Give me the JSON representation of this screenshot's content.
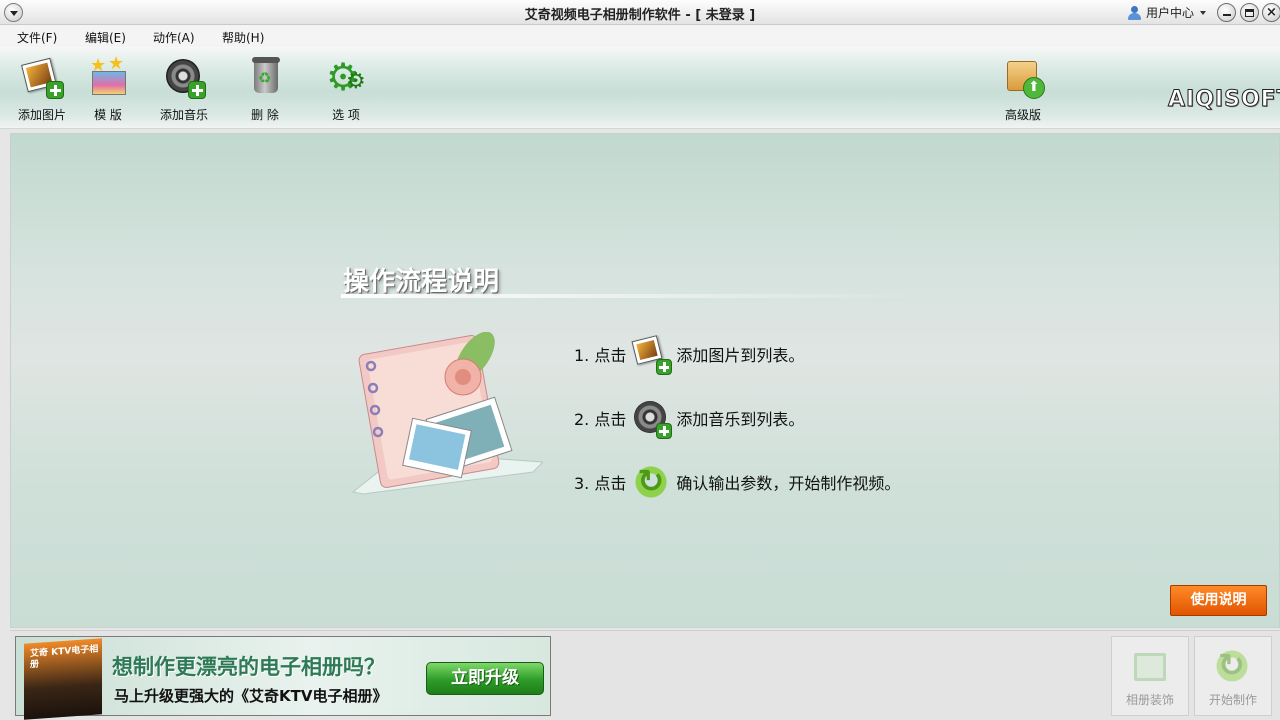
{
  "window": {
    "title": "艾奇视频电子相册制作软件 - [ 未登录 ]",
    "user_center": "用户中心",
    "close_glyph": "×"
  },
  "menu": [
    "文件(F)",
    "编辑(E)",
    "动作(A)",
    "帮助(H)"
  ],
  "toolbar": {
    "add_photo": "添加图片",
    "template": "模 版",
    "add_music": "添加音乐",
    "delete": "删 除",
    "options": "选 项",
    "premium": "高级版",
    "logo": "AIQISOFT"
  },
  "flow": {
    "title": "操作流程说明",
    "steps": [
      {
        "prefix": "1. 点击",
        "text": "添加图片到列表。",
        "icon": "add-photo-icon"
      },
      {
        "prefix": "2. 点击",
        "text": "添加音乐到列表。",
        "icon": "add-music-icon"
      },
      {
        "prefix": "3. 点击",
        "text": "确认输出参数，开始制作视频。",
        "icon": "start-icon"
      }
    ]
  },
  "help_button": "使用说明",
  "banner": {
    "box_text": "艾奇 KTV电子相册",
    "question": "想制作更漂亮的电子相册吗？",
    "subtitle": "马上升级更强大的《艾奇KTV电子相册》",
    "upgrade": "立即升级"
  },
  "bottom_buttons": {
    "decorate": "相册装饰",
    "start": "开始制作"
  },
  "colors": {
    "accent_orange": "#e05500",
    "upgrade_green": "#2d9c28",
    "panel_teal": "#c9ddd5"
  }
}
